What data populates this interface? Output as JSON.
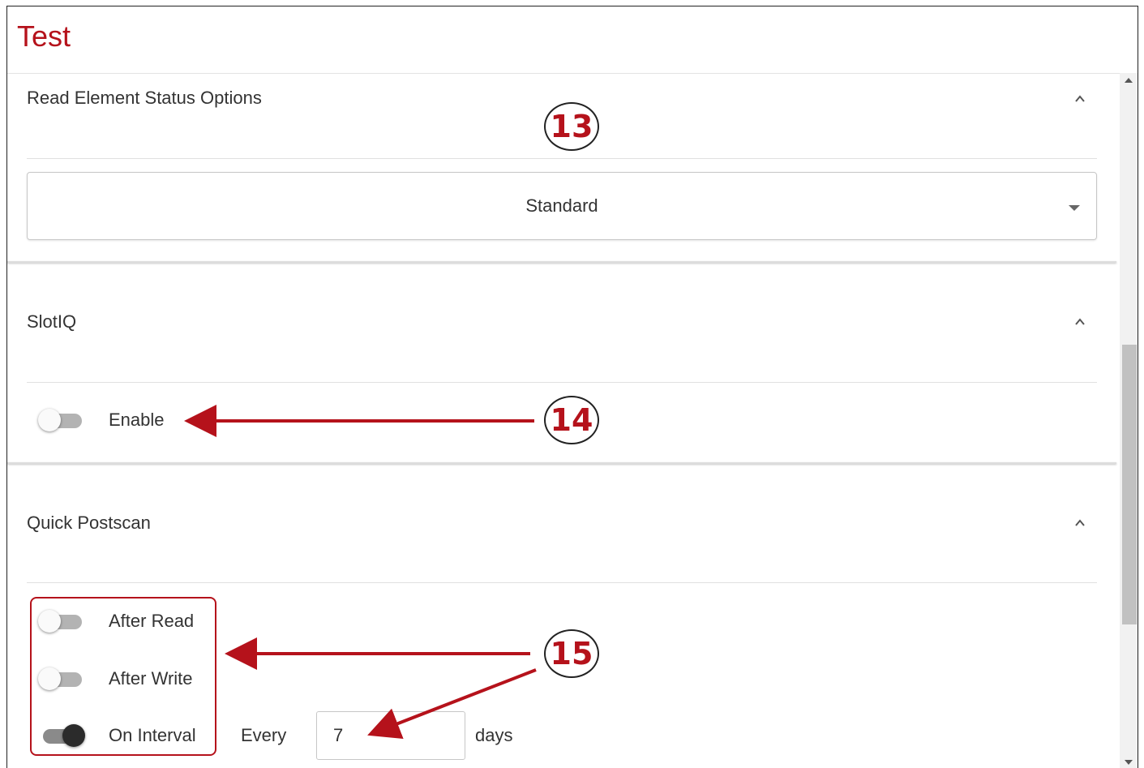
{
  "window": {
    "title": "Test"
  },
  "sections": [
    {
      "title": "Read Element Status Options",
      "select_value": "Standard"
    },
    {
      "title": "SlotIQ",
      "toggles": [
        {
          "label": "Enable",
          "on": false
        }
      ]
    },
    {
      "title": "Quick Postscan",
      "toggles": [
        {
          "label": "After Read",
          "on": false
        },
        {
          "label": "After Write",
          "on": false
        },
        {
          "label": "On Interval",
          "on": true
        }
      ],
      "interval": {
        "prefix": "Every",
        "value": "7",
        "suffix": "days"
      }
    }
  ],
  "callouts": [
    "13",
    "14",
    "15"
  ],
  "icons": {
    "collapse": "chevron-up-icon",
    "dropdown": "caret-down-icon"
  },
  "colors": {
    "accent": "#b5121b"
  }
}
